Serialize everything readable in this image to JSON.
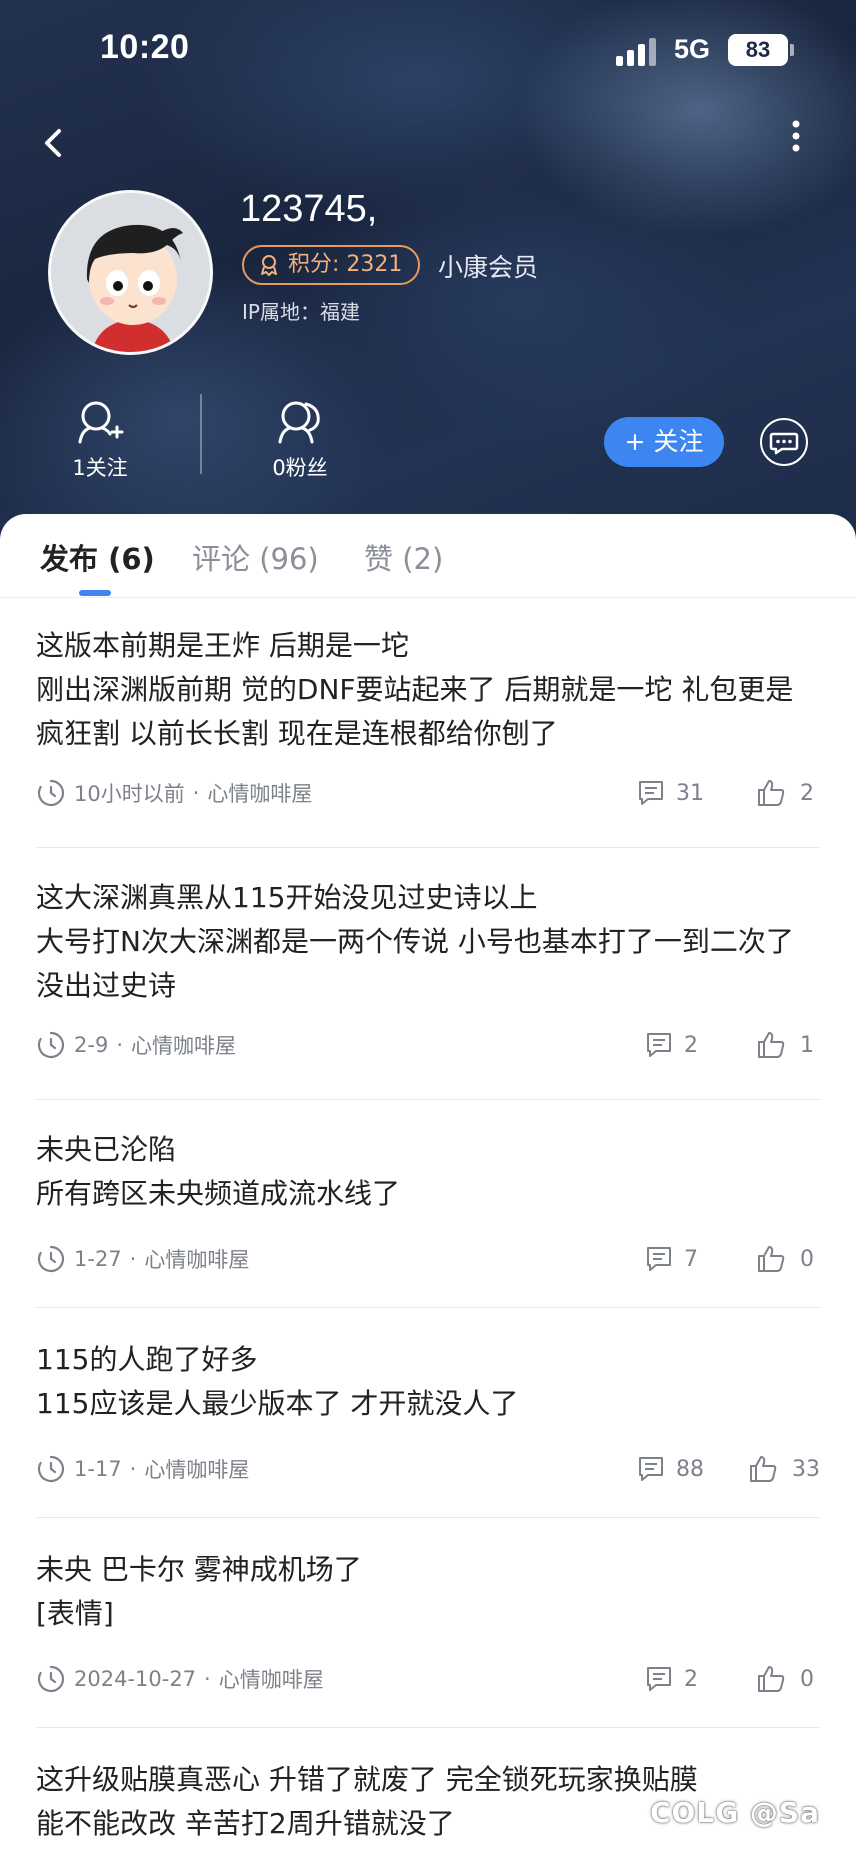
{
  "status_bar": {
    "time": "10:20",
    "network": "5G",
    "battery": "83"
  },
  "profile": {
    "username": "123745,",
    "points_label": "积分: 2321",
    "member_level": "小康会员",
    "ip_location": "IP属地：福建",
    "following_label": "1关注",
    "followers_label": "0粉丝",
    "follow_button": "+ 关注"
  },
  "tabs": [
    {
      "label": "发布 (6)",
      "active": true
    },
    {
      "label": "评论 (96)",
      "active": false
    },
    {
      "label": "赞 (2)",
      "active": false
    }
  ],
  "posts": [
    {
      "title": "这版本前期是王炸 后期是一坨",
      "body": "刚出深渊版前期  觉的DNF要站起来了 后期就是一坨  礼包更是疯狂割 以前长长割 现在是连根都给你刨了",
      "time": "10小时以前",
      "channel": "心情咖啡屋",
      "comments": "31",
      "likes": "2"
    },
    {
      "title": "这大深渊真黑从115开始没见过史诗以上",
      "body": "大号打N次大深渊都是一两个传说  小号也基本打了一到二次了 没出过史诗",
      "time": "2-9",
      "channel": "心情咖啡屋",
      "comments": "2",
      "likes": "1"
    },
    {
      "title": "未央已沦陷",
      "body": "所有跨区未央频道成流水线了",
      "time": "1-27",
      "channel": "心情咖啡屋",
      "comments": "7",
      "likes": "0"
    },
    {
      "title": "115的人跑了好多",
      "body": "115应该是人最少版本了 才开就没人了",
      "time": "1-17",
      "channel": "心情咖啡屋",
      "comments": "88",
      "likes": "33"
    },
    {
      "title": "未央  巴卡尔  雾神成机场了",
      "body": "[表情]",
      "time": "2024-10-27",
      "channel": "心情咖啡屋",
      "comments": "2",
      "likes": "0"
    },
    {
      "title": "这升级贴膜真恶心  升错了就废了 完全锁死玩家换贴膜",
      "body": "能不能改改 辛苦打2周升错就没了",
      "time": "",
      "channel": "",
      "comments": "",
      "likes": ""
    }
  ],
  "meta_separator": "·",
  "watermark": "COLG @Sa",
  "colors": {
    "accent": "#3d86f2",
    "badge": "#e89a5a",
    "header_bg": "#1c2b47"
  }
}
